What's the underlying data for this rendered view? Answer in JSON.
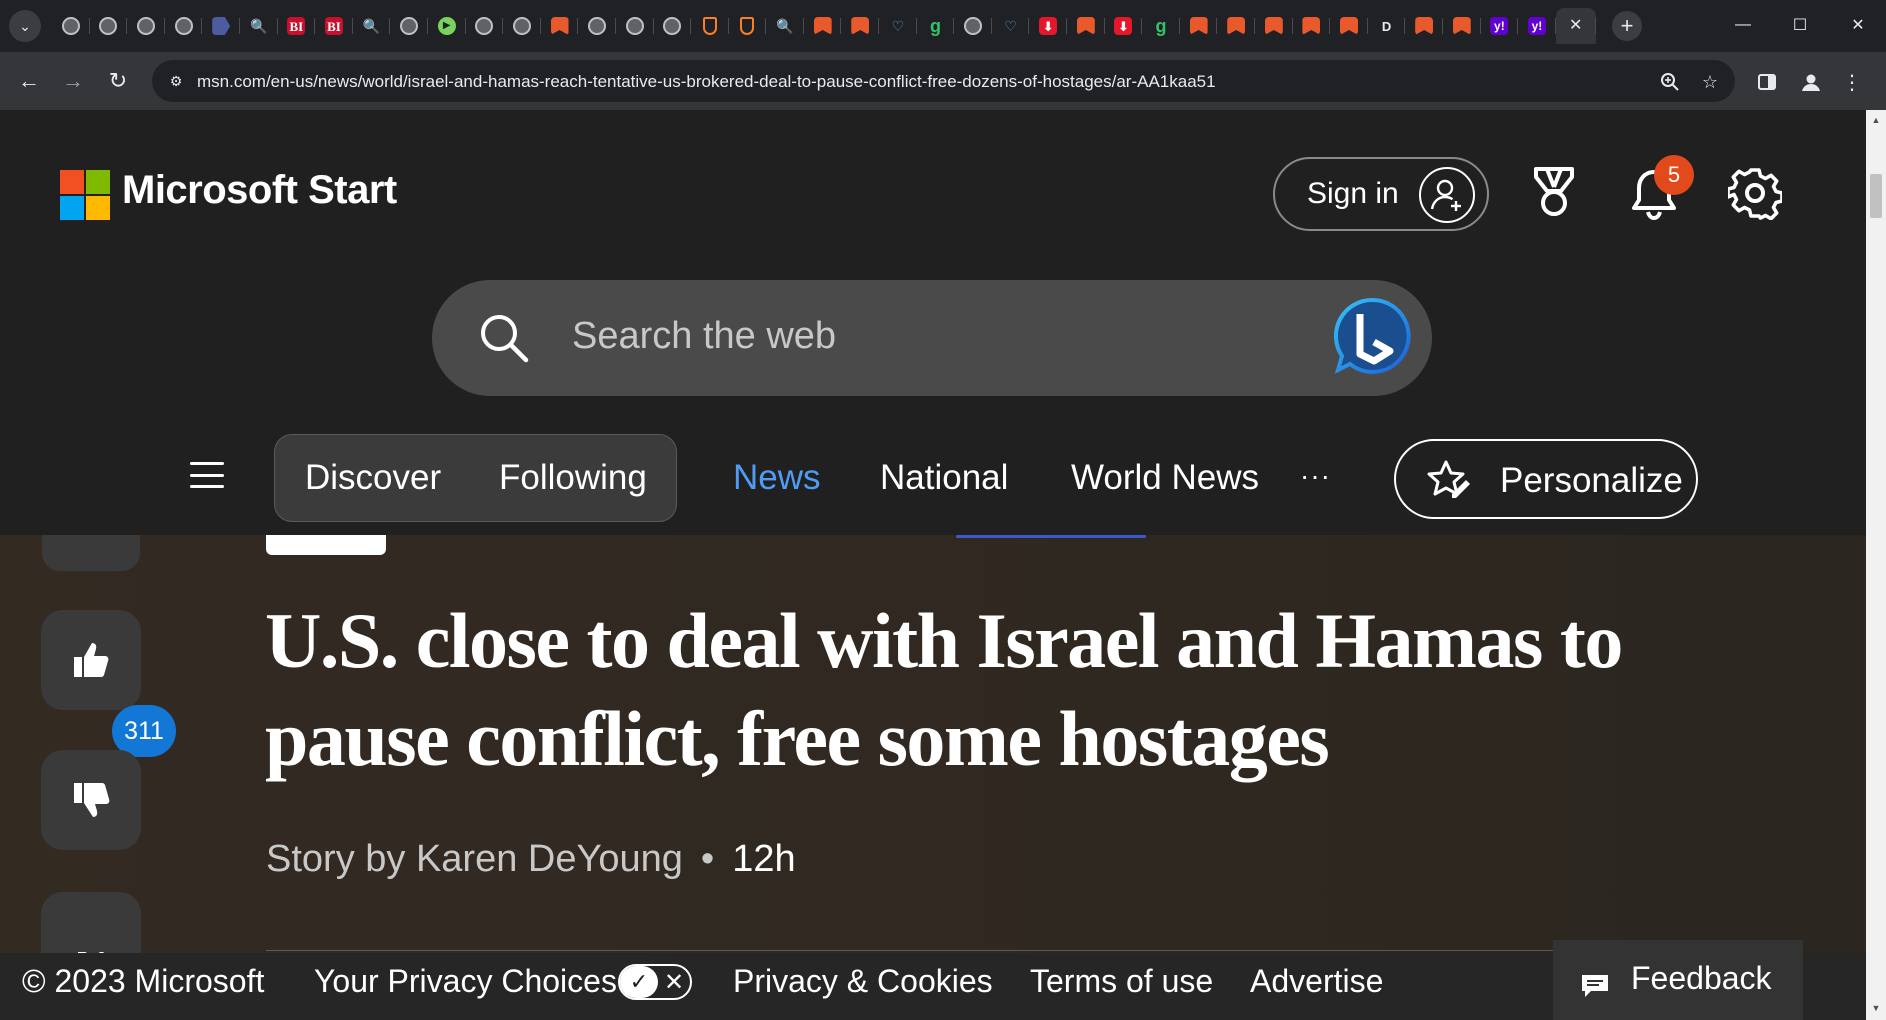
{
  "browser": {
    "tabs": [
      {
        "icon": "globe-icon",
        "glyph": ""
      },
      {
        "icon": "globe-icon",
        "glyph": ""
      },
      {
        "icon": "globe-icon",
        "glyph": ""
      },
      {
        "icon": "globe-icon",
        "glyph": ""
      },
      {
        "icon": "flag-icon",
        "glyph": ""
      },
      {
        "icon": "search-icon",
        "glyph": "🔍"
      },
      {
        "icon": "business-insider-icon",
        "glyph": "BI"
      },
      {
        "icon": "business-insider-icon",
        "glyph": "BI"
      },
      {
        "icon": "search-icon",
        "glyph": "🔍"
      },
      {
        "icon": "globe-icon",
        "glyph": ""
      },
      {
        "icon": "play-icon",
        "glyph": "▶"
      },
      {
        "icon": "globe-icon",
        "glyph": ""
      },
      {
        "icon": "globe-icon",
        "glyph": ""
      },
      {
        "icon": "bookmark-icon",
        "glyph": ""
      },
      {
        "icon": "globe-icon",
        "glyph": ""
      },
      {
        "icon": "globe-icon",
        "glyph": ""
      },
      {
        "icon": "globe-icon",
        "glyph": ""
      },
      {
        "icon": "shield-icon",
        "glyph": ""
      },
      {
        "icon": "shield-icon",
        "glyph": ""
      },
      {
        "icon": "search-icon",
        "glyph": "🔍"
      },
      {
        "icon": "bookmark-icon",
        "glyph": ""
      },
      {
        "icon": "bookmark-icon",
        "glyph": ""
      },
      {
        "icon": "heart-icon",
        "glyph": "♡"
      },
      {
        "icon": "g-icon",
        "glyph": "g"
      },
      {
        "icon": "globe-icon",
        "glyph": ""
      },
      {
        "icon": "heart-icon",
        "glyph": "♡"
      },
      {
        "icon": "red-download-icon",
        "glyph": "⬇"
      },
      {
        "icon": "bookmark-icon",
        "glyph": ""
      },
      {
        "icon": "red-download-icon",
        "glyph": "⬇"
      },
      {
        "icon": "g-icon",
        "glyph": "g"
      },
      {
        "icon": "bookmark-icon",
        "glyph": ""
      },
      {
        "icon": "bookmark-icon",
        "glyph": ""
      },
      {
        "icon": "bookmark-icon",
        "glyph": ""
      },
      {
        "icon": "bookmark-icon",
        "glyph": ""
      },
      {
        "icon": "bookmark-icon",
        "glyph": ""
      },
      {
        "icon": "d-icon",
        "glyph": "D"
      },
      {
        "icon": "bookmark-icon",
        "glyph": ""
      },
      {
        "icon": "bookmark-icon",
        "glyph": ""
      },
      {
        "icon": "yahoo-icon",
        "glyph": "y!"
      },
      {
        "icon": "yahoo-icon",
        "glyph": "y!"
      }
    ],
    "active_tab_close": "✕",
    "new_tab": "+",
    "url": "msn.com/en-us/news/world/israel-and-hamas-reach-tentative-us-brokered-deal-to-pause-conflict-free-dozens-of-hostages/ar-AA1kaa51"
  },
  "header": {
    "brand": "Microsoft Start",
    "logo_colors": [
      "#f25022",
      "#7fba00",
      "#00a4ef",
      "#ffb900"
    ],
    "sign_in": "Sign in",
    "notification_count": "5",
    "search_placeholder": "Search the web"
  },
  "nav": {
    "discover": "Discover",
    "following": "Following",
    "items": [
      {
        "label": "News",
        "active": true
      },
      {
        "label": "National",
        "active": false
      },
      {
        "label": "World News",
        "active": false
      }
    ],
    "more": "···",
    "personalize": "Personalize",
    "active_color": "#4f9cf5"
  },
  "article": {
    "like_count": "311",
    "headline": "U.S. close to deal with Israel and Hamas to pause conflict, free some hostages",
    "byline": "Story by Karen DeYoung",
    "bullet": "•",
    "time": "12h"
  },
  "footer": {
    "copyright": "© 2023 Microsoft",
    "privacy_choices": "Your Privacy Choices",
    "privacy_cookies": "Privacy & Cookies",
    "terms": "Terms of use",
    "advertise": "Advertise",
    "feedback": "Feedback"
  }
}
